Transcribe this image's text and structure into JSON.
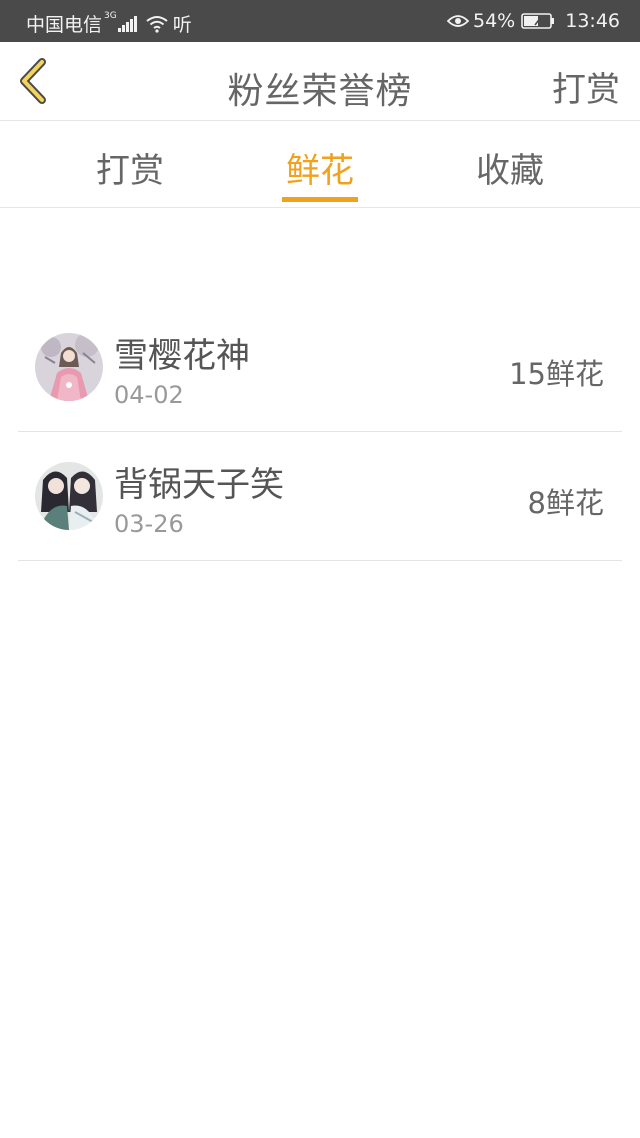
{
  "status_bar": {
    "carrier": "中国电信",
    "network": "3G",
    "listen": "听",
    "battery": "54%",
    "time": "13:46"
  },
  "header": {
    "title": "粉丝荣誉榜",
    "action": "打赏"
  },
  "tabs": [
    {
      "label": "打赏",
      "active": false
    },
    {
      "label": "鲜花",
      "active": true
    },
    {
      "label": "收藏",
      "active": false
    }
  ],
  "fans": [
    {
      "name": "雪樱花神",
      "date": "04-02",
      "count": "15鲜花",
      "avatar": "anime-girl-pink-avatar"
    },
    {
      "name": "背锅天子笑",
      "date": "03-26",
      "count": "8鲜花",
      "avatar": "anime-pair-avatar"
    }
  ],
  "colors": {
    "accent": "#f0a21d",
    "back_arrow": "#f3d55b",
    "status_bar": "#4a4a4a"
  }
}
